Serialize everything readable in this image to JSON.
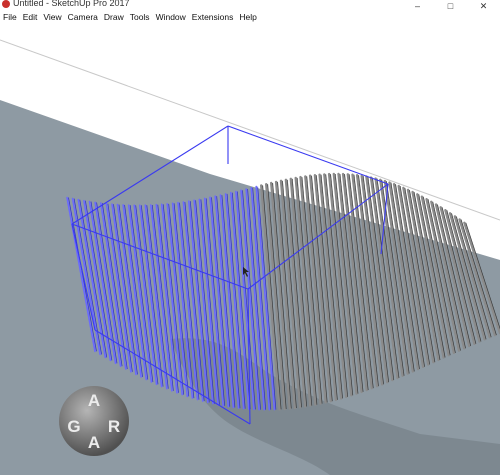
{
  "window": {
    "title": "Untitled - SketchUp Pro 2017",
    "controls": [
      "–",
      "□",
      "✕"
    ]
  },
  "menu": [
    "File",
    "Edit",
    "View",
    "Camera",
    "Draw",
    "Tools",
    "Window",
    "Extensions",
    "Help"
  ],
  "viewport": {
    "ground_color": "#8e9aa3",
    "sky_color": "#ffffff",
    "selection_color": "#3a3af0",
    "fin_color": "#8b8b8b",
    "selected_fin_color": "#6a6aff",
    "selected_fins": 36,
    "unselected_fins": 44
  },
  "logo": {
    "letters": [
      "A",
      "G",
      "A",
      "R"
    ]
  }
}
